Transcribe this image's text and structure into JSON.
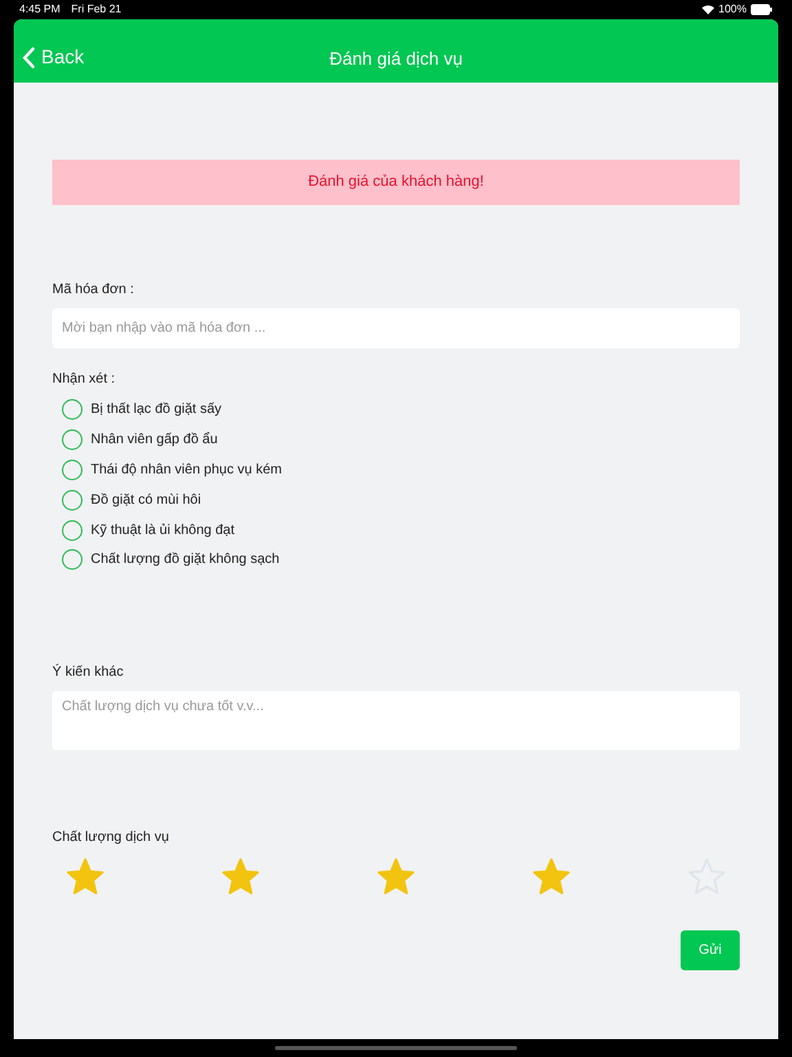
{
  "status_bar": {
    "time": "4:45 PM",
    "date": "Fri Feb 21",
    "battery": "100%"
  },
  "nav": {
    "back": "Back",
    "title": "Đánh giá dịch vụ"
  },
  "alert": "Đánh giá của khách hàng!",
  "invoice": {
    "label": "Mã hóa đơn :",
    "placeholder": "Mời bạn nhập vào mã hóa đơn ..."
  },
  "comments": {
    "label": "Nhận xét :",
    "options": [
      {
        "label": "Bị thất lạc đồ giặt sấy",
        "checked": false
      },
      {
        "label": "Nhân viên gấp đồ ẩu",
        "checked": false
      },
      {
        "label": "Thái độ nhân viên phục vụ kém",
        "checked": false
      },
      {
        "label": "Đồ giặt có mùi hôi",
        "checked": false
      },
      {
        "label": "Kỹ thuật là ủi không đạt",
        "checked": false
      },
      {
        "label": "Chất lượng đồ giặt không sạch",
        "checked": false
      }
    ]
  },
  "other": {
    "label": "Ý kiến khác",
    "placeholder": "Chất lượng dịch vụ chưa tốt v.v..."
  },
  "rating": {
    "label": "Chất lượng dịch vụ",
    "stars": 4
  },
  "submit": "Gửi"
}
